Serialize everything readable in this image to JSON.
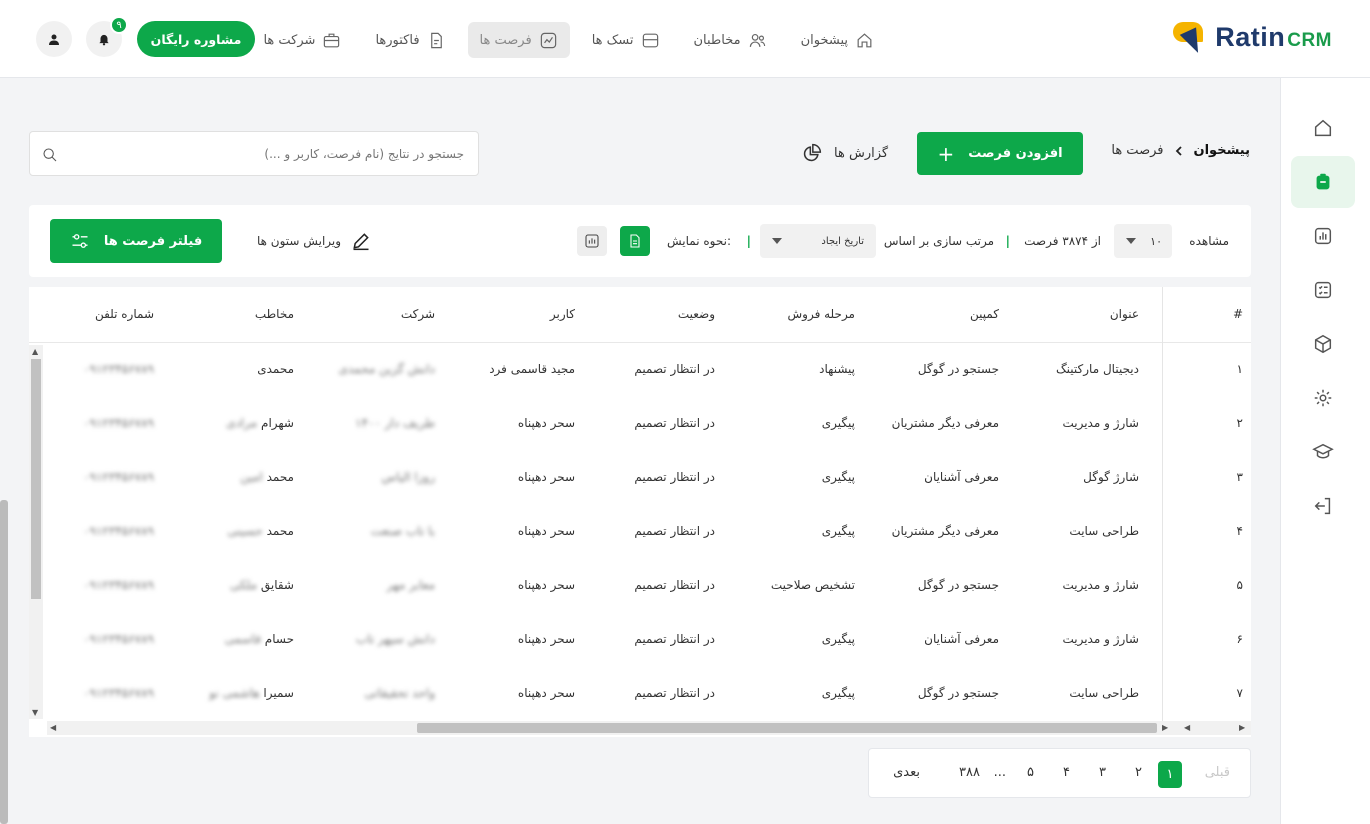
{
  "brand": {
    "name": "Ratin",
    "suffix": "CRM"
  },
  "nav": [
    {
      "label": "پیشخوان",
      "icon": "home-icon"
    },
    {
      "label": "مخاطبان",
      "icon": "users-icon"
    },
    {
      "label": "تسک ها",
      "icon": "folder-icon"
    },
    {
      "label": "فرصت ها",
      "icon": "chart-icon",
      "active": true
    },
    {
      "label": "فاکتورها",
      "icon": "document-icon"
    },
    {
      "label": "شرکت ها",
      "icon": "briefcase-icon"
    }
  ],
  "header": {
    "consult_label": "مشاوره رایگان",
    "notif_count": "۹"
  },
  "breadcrumb": {
    "home": "پیشخوان",
    "current": "فرصت ها"
  },
  "actions": {
    "add_label": "افزودن فرصت",
    "reports_label": "گزارش ها"
  },
  "search": {
    "placeholder": "جستجو در نتایج (نام فرصت، کاربر و ...)"
  },
  "toolbar": {
    "show_label": "مشاهده",
    "per_page": "۱۰",
    "of_text": "از ۳۸۷۴ فرصت",
    "sort_label": "مرتب سازی بر اساس",
    "sort_value": "تاریخ ایجاد",
    "view_label": "نحوه نمایش:",
    "edit_columns_label": "ویرایش ستون ها",
    "filter_label": "فیلتر فرصت ها"
  },
  "table": {
    "headers": {
      "hash": "#",
      "title": "عنوان",
      "campaign": "کمپین",
      "stage": "مرحله فروش",
      "status": "وضعیت",
      "user": "کاربر",
      "company": "شرکت",
      "contact": "مخاطب",
      "phone": "شماره تلفن"
    },
    "rows": [
      {
        "n": "۱",
        "title": "دیجیتال مارکتینگ",
        "campaign": "جستجو در گوگل",
        "stage": "پیشنهاد",
        "status": "در انتظار تصمیم",
        "user": "مجید قاسمی فرد",
        "company": "دانش گزین محمدی",
        "contact_first": "محمدی",
        "contact_blur": "",
        "phone": "۰۹۱۲۳۴۵۶۷۸۹"
      },
      {
        "n": "۲",
        "title": "شارژ و مدیریت",
        "campaign": "معرفی دیگر مشتریان",
        "stage": "پیگیری",
        "status": "در انتظار تصمیم",
        "user": "سحر دهپناه",
        "company": "طریف دار ۱۴۰۰",
        "contact_first": "شهرام",
        "contact_blur": "مرادی",
        "phone": "۰۹۱۲۳۴۵۶۷۸۹"
      },
      {
        "n": "۳",
        "title": "شارژ گوگل",
        "campaign": "معرفی آشنایان",
        "stage": "پیگیری",
        "status": "در انتظار تصمیم",
        "user": "سحر دهپناه",
        "company": "روزا الیاس",
        "contact_first": "محمد",
        "contact_blur": "امین",
        "phone": "۰۹۱۲۳۴۵۶۷۸۹"
      },
      {
        "n": "۴",
        "title": "طراحی سایت",
        "campaign": "معرفی دیگر مشتریان",
        "stage": "پیگیری",
        "status": "در انتظار تصمیم",
        "user": "سحر دهپناه",
        "company": "با تاب صنعت",
        "contact_first": "محمد",
        "contact_blur": "حسینی",
        "phone": "۰۹۱۲۳۴۵۶۷۸۹"
      },
      {
        "n": "۵",
        "title": "شارژ و مدیریت",
        "campaign": "جستجو در گوگل",
        "stage": "تشخیص صلاحیت",
        "status": "در انتظار تصمیم",
        "user": "سحر دهپناه",
        "company": "معابر مهر",
        "contact_first": "شقایق",
        "contact_blur": "ملکی",
        "phone": "۰۹۱۲۳۴۵۶۷۸۹"
      },
      {
        "n": "۶",
        "title": "شارژ و مدیریت",
        "campaign": "معرفی آشنایان",
        "stage": "پیگیری",
        "status": "در انتظار تصمیم",
        "user": "سحر دهپناه",
        "company": "دانش سپهر تاب",
        "contact_first": "حسام",
        "contact_blur": "قاسمی",
        "phone": "۰۹۱۲۳۴۵۶۷۸۹"
      },
      {
        "n": "۷",
        "title": "طراحی سایت",
        "campaign": "جستجو در گوگل",
        "stage": "پیگیری",
        "status": "در انتظار تصمیم",
        "user": "سحر دهپناه",
        "company": "واحد تحقیقاتی",
        "contact_first": "سمیرا",
        "contact_blur": "هاشمی نو",
        "phone": "۰۹۱۲۳۴۵۶۷۸۹"
      }
    ]
  },
  "pagination": {
    "prev": "قبلی",
    "pages": [
      "۱",
      "۲",
      "۳",
      "۴",
      "۵",
      "...",
      "۳۸۸"
    ],
    "next": "بعدی"
  },
  "colors": {
    "accent": "#0da84a",
    "brand_navy": "#1f3a6b",
    "brand_yellow": "#f5b400"
  }
}
